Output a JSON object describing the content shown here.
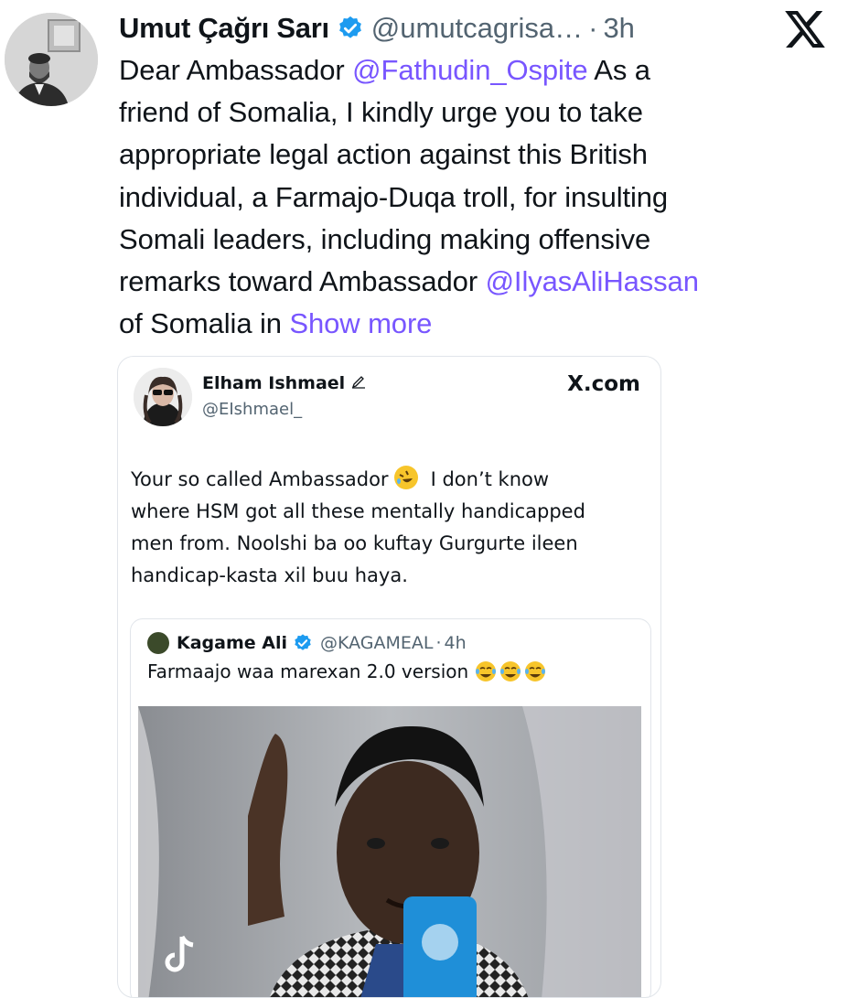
{
  "tweet": {
    "author_name": "Umut Çağrı Sarı",
    "handle": "@umutcagrisa…",
    "separator": "·",
    "time": "3h",
    "text_lines": [
      [
        {
          "t": "Dear Ambassador ",
          "m": false
        },
        {
          "t": "@Fathudin_Ospite",
          "m": true
        },
        {
          "t": " As a",
          "m": false
        }
      ],
      [
        {
          "t": "friend of Somalia, I kindly urge you to take",
          "m": false
        }
      ],
      [
        {
          "t": "appropriate legal action against this British",
          "m": false
        }
      ],
      [
        {
          "t": "individual, a Farmajo-Duqa troll, for insulting",
          "m": false
        }
      ],
      [
        {
          "t": "Somali leaders, including making offensive",
          "m": false
        }
      ],
      [
        {
          "t": "remarks toward Ambassador ",
          "m": false
        },
        {
          "t": "@IlyasAliHassan",
          "m": true
        }
      ],
      [
        {
          "t": "of Somalia in ",
          "m": false
        }
      ]
    ],
    "show_more": "Show more",
    "mention_color": "#7856ff"
  },
  "embedded": {
    "name": "Elham Ishmael",
    "handle": "@EIshmael_",
    "source": "X.com",
    "body_lines": [
      "Your so called Ambassador",
      "I don’t know",
      "where HSM got all these mentally handicapped",
      "men from. Noolshi ba oo kuftay Gurgurte ileen",
      "handicap-kasta xil buu haya."
    ],
    "quote": {
      "name": "Kagame Ali",
      "handle": "@KAGAMEAL",
      "separator": "·",
      "time": "4h",
      "text": "Farmaajo waa marexan 2.0 version"
    }
  },
  "icons": {
    "x_logo": "x-logo-icon",
    "verified": "verified-badge-icon",
    "pen": "pen-icon",
    "emoji_laughing": "rolling-on-floor-laughing-emoji",
    "emoji_tears": "face-with-tears-of-joy-emoji",
    "tiktok": "tiktok-icon"
  },
  "colors": {
    "verified_blue": "#1d9bf0",
    "text": "#0f1419",
    "muted": "#536471"
  }
}
